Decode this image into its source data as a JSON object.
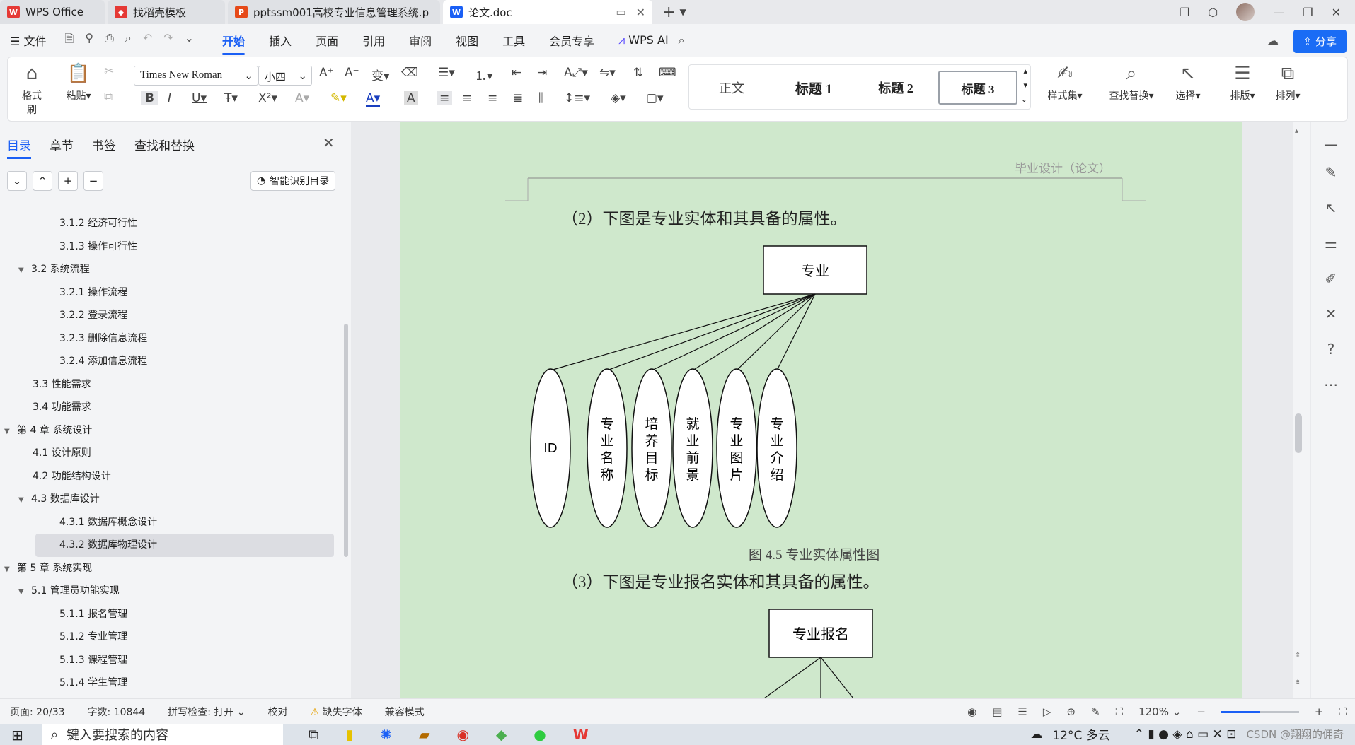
{
  "titlebar": {
    "tabs": [
      {
        "label": "WPS Office",
        "icon": "wps-icon",
        "color": "#e53935"
      },
      {
        "label": "找稻壳模板",
        "icon": "docer-icon",
        "color": "#e53935"
      },
      {
        "label": "pptssm001高校专业信息管理系统.p",
        "icon": "ppt-icon",
        "color": "#e64a19"
      },
      {
        "label": "论文.doc",
        "icon": "word-icon",
        "color": "#1a5ff5"
      }
    ]
  },
  "menubar": {
    "file": "文件",
    "items": [
      "开始",
      "插入",
      "页面",
      "引用",
      "审阅",
      "视图",
      "工具",
      "会员专享"
    ],
    "active": "开始",
    "wps_ai": "WPS AI",
    "share": "分享"
  },
  "ribbon": {
    "format_painter": "格式刷",
    "paste": "粘贴",
    "font_name": "Times New Roman",
    "font_size": "小四",
    "styles": [
      "正文",
      "标题 1",
      "标题 2",
      "标题 3"
    ],
    "style_set": "样式集",
    "find_replace": "查找替换",
    "select": "选择",
    "layout": "排版",
    "arrange": "排列"
  },
  "nav": {
    "tabs": [
      "目录",
      "章节",
      "书签",
      "查找和替换"
    ],
    "smart_toc": "智能识别目录",
    "items": [
      {
        "text": "3.1.2  经济可行性",
        "level": 3
      },
      {
        "text": "3.1.3  操作可行性",
        "level": 3
      },
      {
        "text": "3.2  系统流程",
        "level": 2,
        "expanded": true
      },
      {
        "text": "3.2.1  操作流程",
        "level": 3
      },
      {
        "text": "3.2.2  登录流程",
        "level": 3
      },
      {
        "text": "3.2.3  删除信息流程",
        "level": 3
      },
      {
        "text": "3.2.4  添加信息流程",
        "level": 3
      },
      {
        "text": "3.3  性能需求",
        "level": 2
      },
      {
        "text": "3.4  功能需求",
        "level": 2
      },
      {
        "text": "第 4 章  系统设计",
        "level": 1,
        "expanded": true
      },
      {
        "text": "4.1  设计原则",
        "level": 2
      },
      {
        "text": "4.2  功能结构设计",
        "level": 2
      },
      {
        "text": "4.3  数据库设计",
        "level": 2,
        "expanded": true
      },
      {
        "text": "4.3.1  数据库概念设计",
        "level": 3
      },
      {
        "text": "4.3.2  数据库物理设计",
        "level": 3,
        "selected": true
      },
      {
        "text": "第 5 章  系统实现",
        "level": 1,
        "expanded": true
      },
      {
        "text": "5.1  管理员功能实现",
        "level": 2,
        "expanded": true
      },
      {
        "text": "5.1.1  报名管理",
        "level": 3
      },
      {
        "text": "5.1.2  专业管理",
        "level": 3
      },
      {
        "text": "5.1.3  课程管理",
        "level": 3
      },
      {
        "text": "5.1.4  学生管理",
        "level": 3
      }
    ]
  },
  "document": {
    "header": "毕业设计（论文）",
    "para2": "（2）下图是专业实体和其具备的属性。",
    "entity1": "专业",
    "attributes1": [
      "ID",
      "专业名称",
      "培养目标",
      "就业前景",
      "专业图片",
      "专业介绍"
    ],
    "caption1": "图 4.5  专业实体属性图",
    "para3": "（3）下图是专业报名实体和其具备的属性。",
    "entity2": "专业报名"
  },
  "status": {
    "page": "页面: 20/33",
    "words": "字数: 10844",
    "spell": "拼写检查: 打开",
    "proof": "校对",
    "missing_font": "缺失字体",
    "compat": "兼容模式",
    "zoom": "120%",
    "zoom_fraction": 0.5
  },
  "taskbar": {
    "search_placeholder": "键入要搜索的内容",
    "weather": "12°C  多云",
    "watermark": "CSDN @翔翔的佣奇"
  }
}
